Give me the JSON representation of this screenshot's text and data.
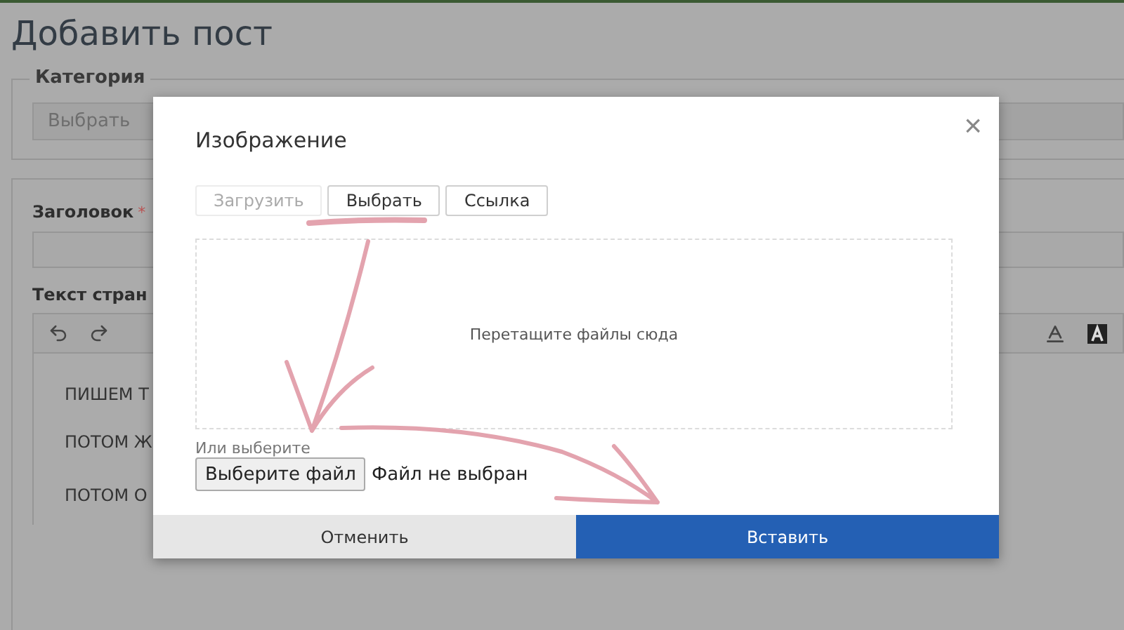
{
  "page": {
    "title": "Добавить пост",
    "category": {
      "legend": "Категория",
      "select_value": "Выбрать"
    },
    "form": {
      "title_label": "Заголовок",
      "required_mark": "*",
      "text_label": "Текст стран",
      "editor_lines": [
        "ПИШЕМ Т",
        "ПОТОМ Ж",
        "ПОТОМ О"
      ]
    }
  },
  "dialog": {
    "title": "Изображение",
    "close": "×",
    "tabs": [
      {
        "label": "Загрузить",
        "selected": true
      },
      {
        "label": "Выбрать",
        "selected": false
      },
      {
        "label": "Ссылка",
        "selected": false
      }
    ],
    "dropzone_text": "Перетащите файлы сюда",
    "or_label": "Или выберите",
    "file_button": "Выберите файл",
    "file_status": "Файл не выбран",
    "buttons": [
      {
        "label": "Отменить",
        "kind": "secondary"
      },
      {
        "label": "Вставить",
        "kind": "primary"
      }
    ]
  }
}
